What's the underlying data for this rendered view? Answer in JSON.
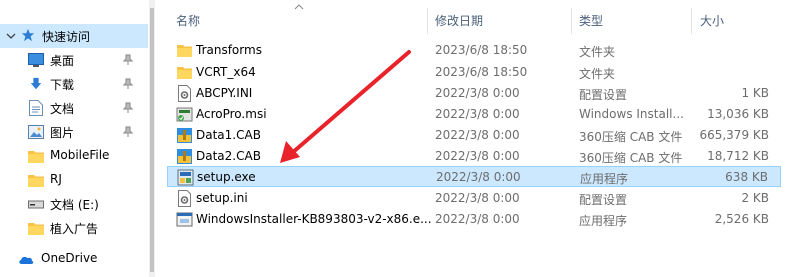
{
  "nav": {
    "items": [
      {
        "label": "快速访问",
        "icon": "star-icon",
        "pinned": false,
        "selected": true
      },
      {
        "label": "桌面",
        "icon": "desktop-icon",
        "pinned": true,
        "selected": false
      },
      {
        "label": "下载",
        "icon": "download-arrow-icon",
        "pinned": true,
        "selected": false
      },
      {
        "label": "文档",
        "icon": "document-icon",
        "pinned": true,
        "selected": false
      },
      {
        "label": "图片",
        "icon": "picture-icon",
        "pinned": true,
        "selected": false
      },
      {
        "label": "MobileFile",
        "icon": "folder-icon",
        "pinned": false,
        "selected": false
      },
      {
        "label": "RJ",
        "icon": "folder-icon",
        "pinned": false,
        "selected": false
      },
      {
        "label": "文档 (E:)",
        "icon": "drive-icon",
        "pinned": false,
        "selected": false
      },
      {
        "label": "植入广告",
        "icon": "folder-icon",
        "pinned": false,
        "selected": false
      },
      {
        "label": "OneDrive",
        "icon": "cloud-icon",
        "pinned": false,
        "selected": false
      }
    ]
  },
  "columns": {
    "name": "名称",
    "date": "修改日期",
    "type": "类型",
    "size": "大小"
  },
  "files": [
    {
      "name": "Transforms",
      "date": "2023/6/8 18:50",
      "type": "文件夹",
      "size": "",
      "icon": "folder-icon",
      "selected": false
    },
    {
      "name": "VCRT_x64",
      "date": "2023/6/8 18:50",
      "type": "文件夹",
      "size": "",
      "icon": "folder-icon",
      "selected": false
    },
    {
      "name": "ABCPY.INI",
      "date": "2022/3/8 0:00",
      "type": "配置设置",
      "size": "1 KB",
      "icon": "ini-file-icon",
      "selected": false
    },
    {
      "name": "AcroPro.msi",
      "date": "2022/3/8 0:00",
      "type": "Windows Install...",
      "size": "13,036 KB",
      "icon": "msi-installer-icon",
      "selected": false
    },
    {
      "name": "Data1.CAB",
      "date": "2022/3/8 0:00",
      "type": "360压缩 CAB 文件",
      "size": "665,379 KB",
      "icon": "cab-archive-icon",
      "selected": false
    },
    {
      "name": "Data2.CAB",
      "date": "2022/3/8 0:00",
      "type": "360压缩 CAB 文件",
      "size": "18,712 KB",
      "icon": "cab-archive-icon",
      "selected": false
    },
    {
      "name": "setup.exe",
      "date": "2022/3/8 0:00",
      "type": "应用程序",
      "size": "638 KB",
      "icon": "setup-exe-icon",
      "selected": true
    },
    {
      "name": "setup.ini",
      "date": "2022/3/8 0:00",
      "type": "配置设置",
      "size": "2 KB",
      "icon": "ini-file-icon",
      "selected": false
    },
    {
      "name": "WindowsInstaller-KB893803-v2-x86.e...",
      "date": "2022/3/8 0:00",
      "type": "应用程序",
      "size": "2,526 KB",
      "icon": "installer-exe-icon",
      "selected": false
    }
  ],
  "annotation": {
    "color": "#e8232a",
    "points_to": "setup.exe"
  }
}
